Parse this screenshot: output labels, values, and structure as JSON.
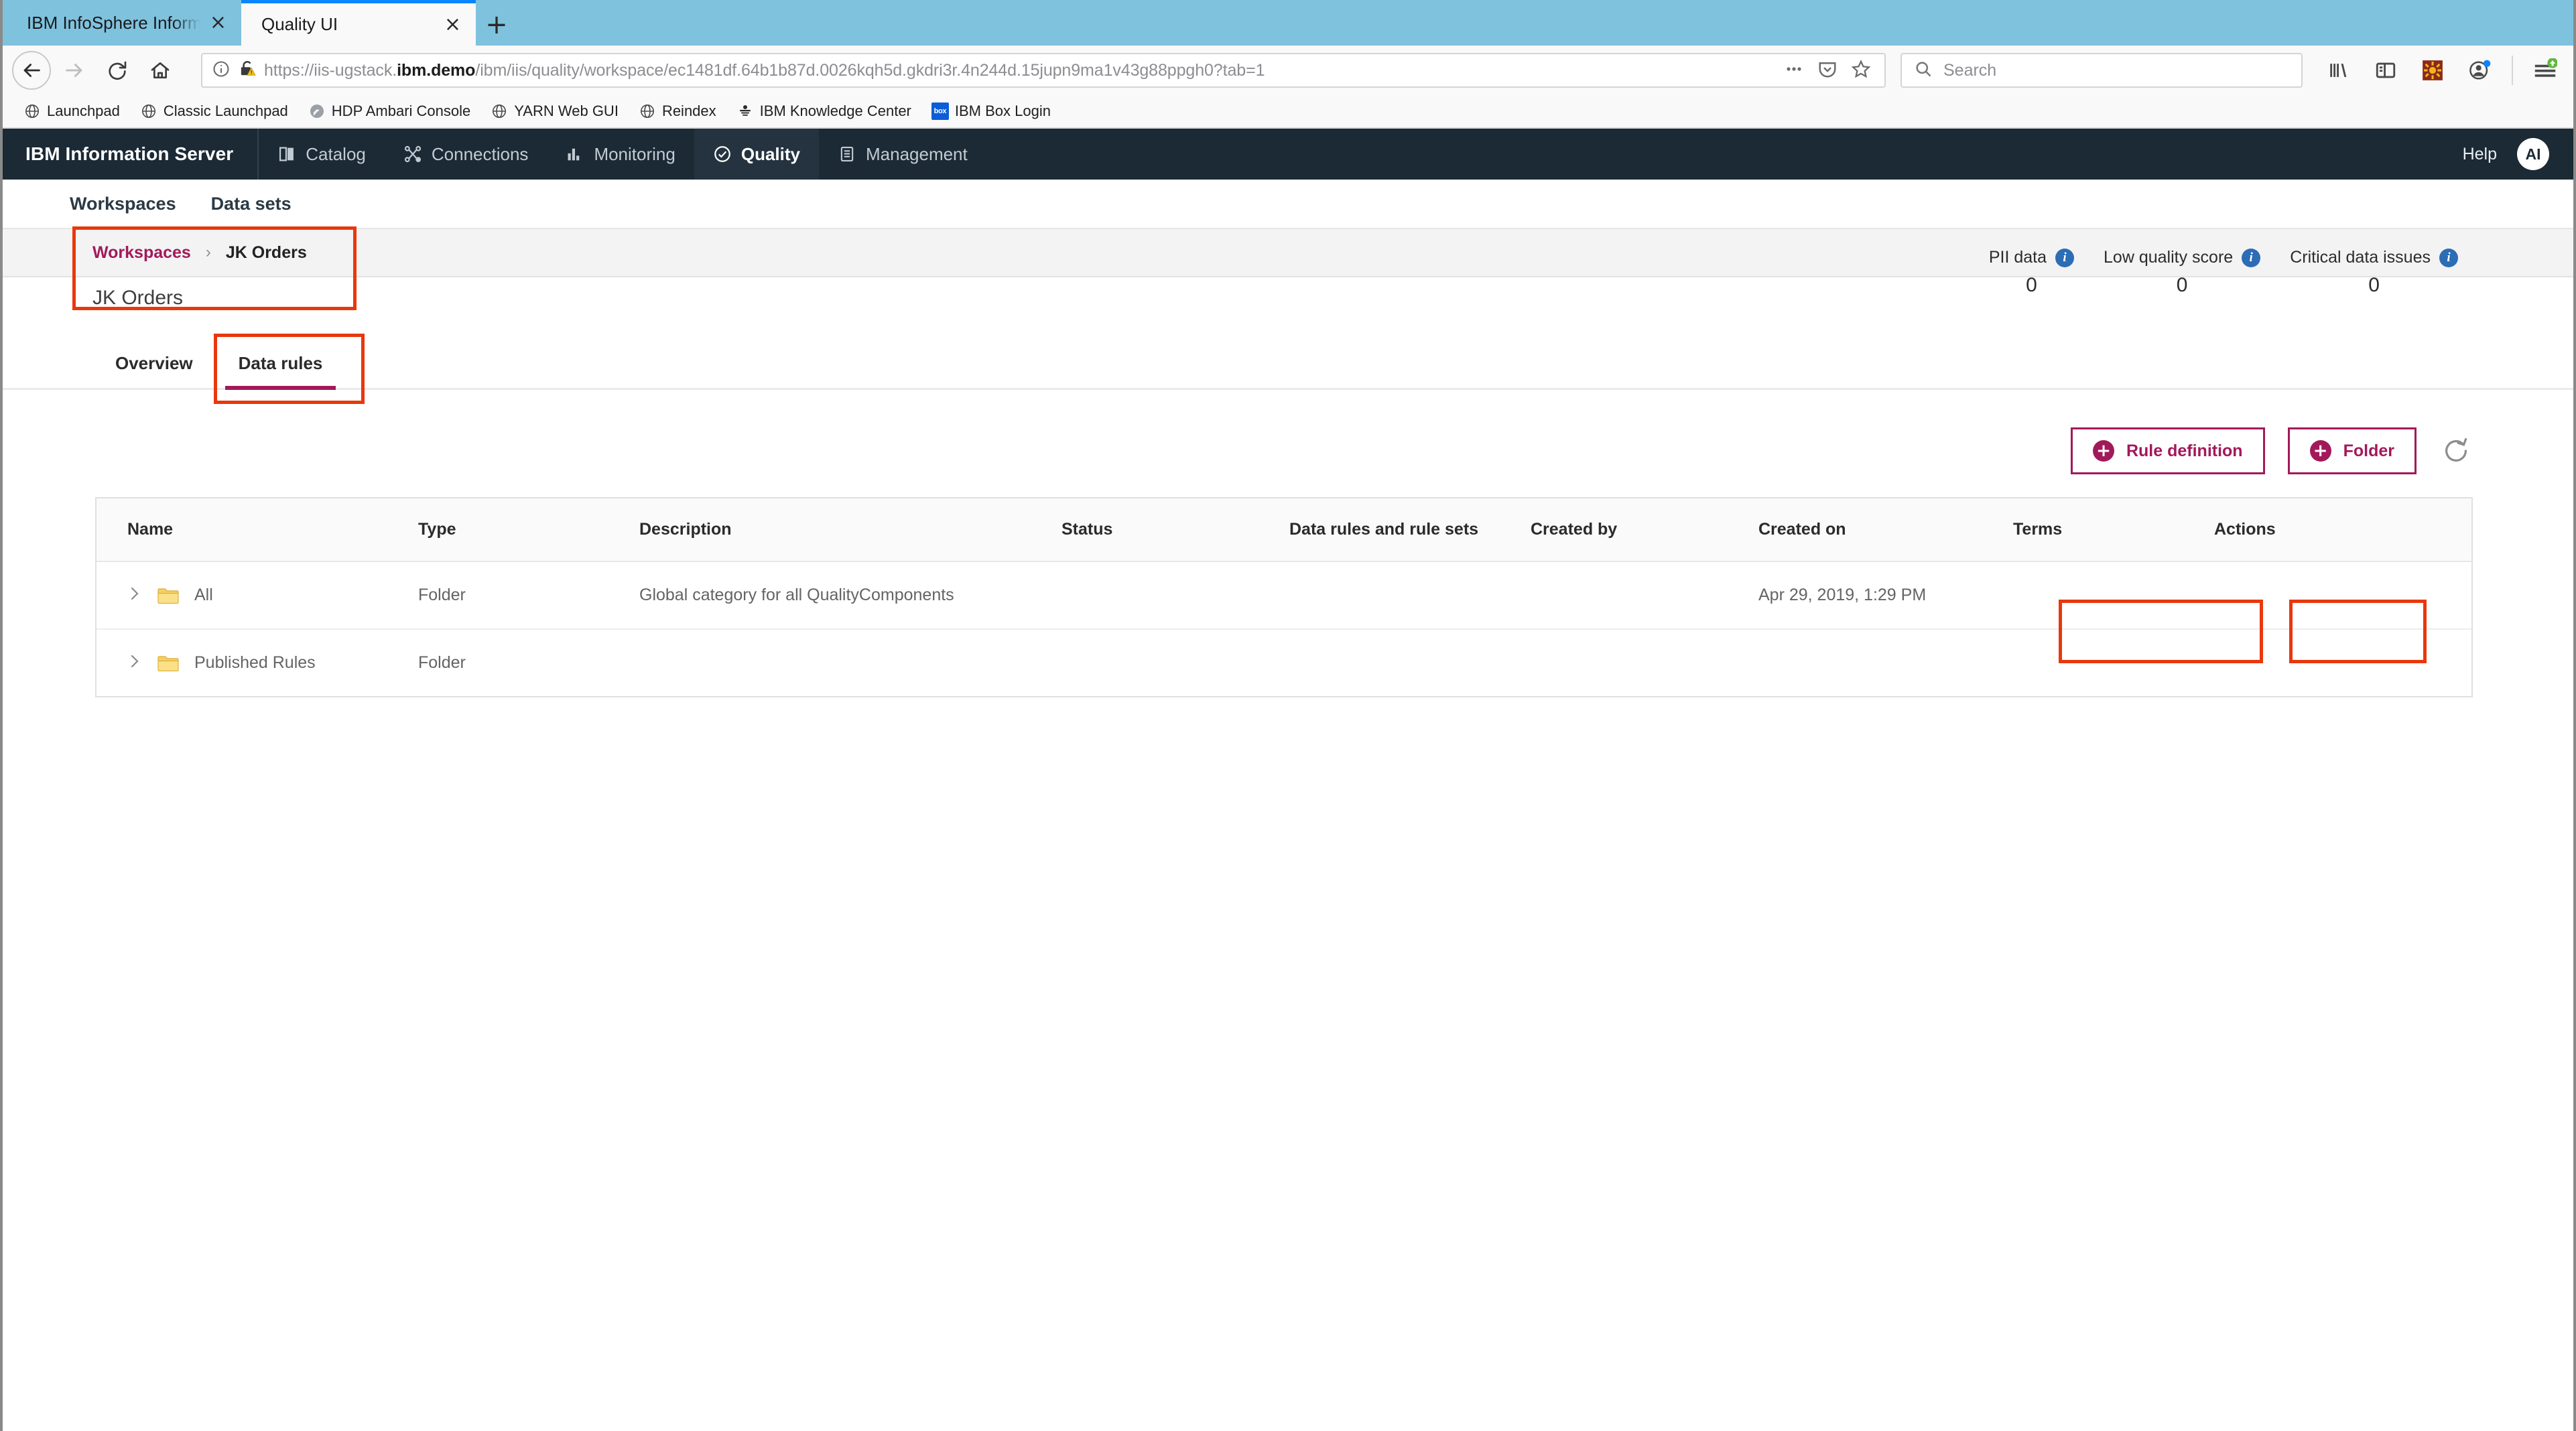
{
  "browser": {
    "tabs": [
      {
        "title": "IBM InfoSphere Information Server",
        "active": false
      },
      {
        "title": "Quality UI",
        "active": true
      }
    ],
    "new_tab_label": "+",
    "close_label": "×",
    "url": "https://iis-ugstack.ibm.demo/ibm/iis/quality/workspace/ec1481df.64b1b87d.0026kqh5d.gkdri3r.4n244d.15jupn9ma1v43g88ppgh0?tab=1",
    "url_host_bold": "ibm.demo",
    "url_prefix": "https://iis-ugstack.",
    "url_suffix": "/ibm/iis/quality/workspace/ec1481df.64b1b87d.0026kqh5d.gkdri3r.4n244d.15jupn9ma1v43g88ppgh0?tab=1",
    "search_placeholder": "Search",
    "bookmarks": [
      {
        "label": "Launchpad",
        "icon": "globe-icon"
      },
      {
        "label": "Classic Launchpad",
        "icon": "globe-icon"
      },
      {
        "label": "HDP Ambari Console",
        "icon": "ambari-icon"
      },
      {
        "label": "YARN Web GUI",
        "icon": "globe-icon"
      },
      {
        "label": "Reindex",
        "icon": "globe-icon"
      },
      {
        "label": "IBM Knowledge Center",
        "icon": "knowledge-center-icon"
      },
      {
        "label": "IBM Box Login",
        "icon": "box-icon"
      }
    ]
  },
  "app": {
    "brand": "IBM Information Server",
    "nav": [
      {
        "label": "Catalog",
        "icon": "book-icon",
        "active": false
      },
      {
        "label": "Connections",
        "icon": "connections-icon",
        "active": false
      },
      {
        "label": "Monitoring",
        "icon": "bar-chart-icon",
        "active": false
      },
      {
        "label": "Quality",
        "icon": "check-circle-icon",
        "active": true
      },
      {
        "label": "Management",
        "icon": "clipboard-icon",
        "active": false
      }
    ],
    "help_label": "Help",
    "avatar_initials": "AI",
    "accent_color": "#a2195b",
    "header_color": "#1b2a35"
  },
  "sub_nav": [
    {
      "label": "Workspaces"
    },
    {
      "label": "Data sets"
    }
  ],
  "breadcrumb": {
    "root": "Workspaces",
    "separator": "›",
    "current": "JK Orders"
  },
  "workspace": {
    "title": "JK Orders"
  },
  "metrics": [
    {
      "label": "PII data",
      "value": "0"
    },
    {
      "label": "Low quality score",
      "value": "0"
    },
    {
      "label": "Critical data issues",
      "value": "0"
    }
  ],
  "tabs": [
    {
      "label": "Overview",
      "active": false
    },
    {
      "label": "Data rules",
      "active": true
    }
  ],
  "actions": {
    "rule_definition_label": "Rule definition",
    "folder_label": "Folder",
    "plus_glyph": "+",
    "refresh_icon": "refresh-icon"
  },
  "table": {
    "columns": [
      "Name",
      "Type",
      "Description",
      "Status",
      "Data rules and rule sets",
      "Created by",
      "Created on",
      "Terms",
      "Actions"
    ],
    "rows": [
      {
        "name": "All",
        "type": "Folder",
        "description": "Global category for all QualityComponents",
        "status": "",
        "rules": "",
        "created_by": "",
        "created_on": "Apr 29, 2019, 1:29 PM",
        "terms": "",
        "actions": ""
      },
      {
        "name": "Published Rules",
        "type": "Folder",
        "description": "",
        "status": "",
        "rules": "",
        "created_by": "",
        "created_on": "",
        "terms": "",
        "actions": ""
      }
    ]
  },
  "annotations": {
    "color": "#e8380d",
    "boxes": [
      {
        "name": "breadcrumb-highlight"
      },
      {
        "name": "data-rules-tab-highlight"
      },
      {
        "name": "rule-definition-highlight"
      },
      {
        "name": "folder-button-highlight"
      }
    ]
  }
}
